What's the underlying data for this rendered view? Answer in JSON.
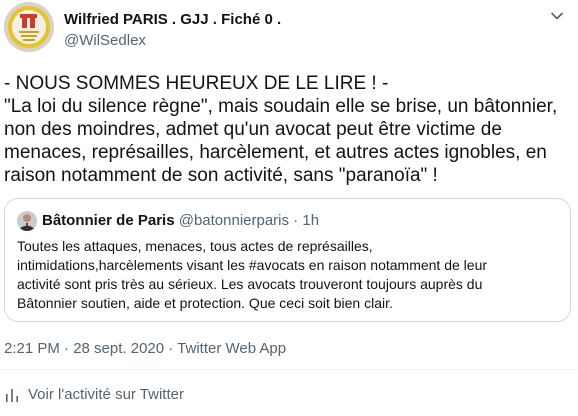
{
  "author": {
    "display_name": "Wilfried PARIS . GJJ . Fiché 0 .",
    "handle": "@WilSedlex",
    "avatar_icon": "gilets-jaunes-logo-avatar"
  },
  "tweet": {
    "text": "- NOUS SOMMES HEUREUX DE LE LIRE ! -\n\"La loi du silence règne\", mais soudain elle se brise, un bâtonnier,\nnon des moindres, admet qu'un avocat peut être victime de\nmenaces, représailles, harcèlement, et autres actes ignobles, en\nraison notamment de son activité, sans \"paranoïa\" !"
  },
  "quote": {
    "name": "Bâtonnier de Paris",
    "handle": "@batonnierparis",
    "separator": "·",
    "time": "1h",
    "text": "Toutes les attaques, menaces, tous actes de représailles,\nintimidations,harcèlements visant les #avocats en raison notamment de leur\nactivité sont pris très au sérieux. Les avocats trouveront toujours auprès du\nBâtonnier soutien, aide et protection. Que ceci soit bien clair."
  },
  "timestamp": "2:21 PM · 28 sept. 2020 · Twitter Web App",
  "activity_label": "Voir l'activité sur Twitter",
  "colors": {
    "text": "#0f1419",
    "secondary": "#536471",
    "border": "#cfd9de",
    "avatar_yellow": "#e6c428",
    "avatar_red": "#d03a2a"
  }
}
